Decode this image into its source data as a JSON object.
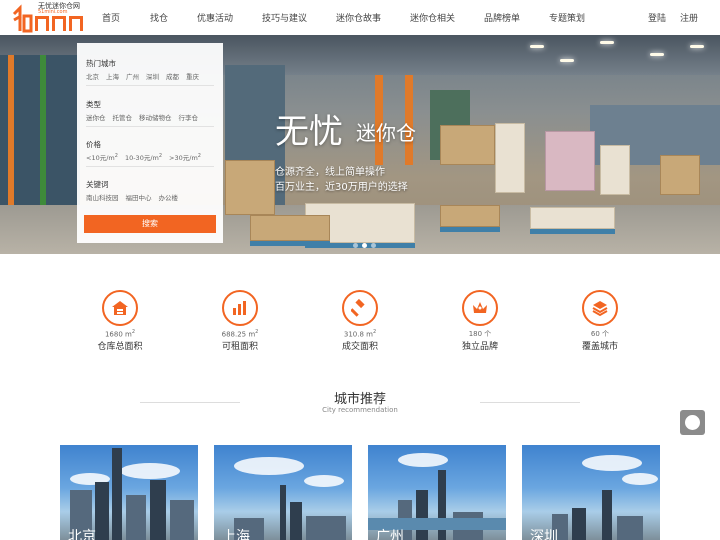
{
  "logo": {
    "text": "无忧迷你仓网",
    "url_text": "51mini.com",
    "brand_color": "#f26522"
  },
  "nav": {
    "items": [
      "首页",
      "找仓",
      "优惠活动",
      "技巧与建议",
      "迷你仓故事",
      "迷你仓相关",
      "品牌榜单",
      "专题策划"
    ],
    "login": "登陆",
    "register": "注册"
  },
  "search_panel": {
    "hot_city_label": "热门城市",
    "hot_cities": [
      "北京",
      "上海",
      "广州",
      "深圳",
      "成都",
      "重庆"
    ],
    "type_label": "类型",
    "types": [
      "迷你仓",
      "托管仓",
      "移动储物仓",
      "行李仓"
    ],
    "price_label": "价格",
    "prices": [
      "<10元/m",
      "10-30元/m",
      ">30元/m"
    ],
    "price_sup": "2",
    "keyword_label": "关键词",
    "keywords": [
      "南山科技园",
      "福田中心",
      "办公楼"
    ],
    "search_button": "搜索"
  },
  "hero": {
    "title": "无忧",
    "subtitle": "迷你仓",
    "line1": "仓源齐全，线上简单操作",
    "line2": "百万业主，近30万用户的选择"
  },
  "stats": [
    {
      "value": "1680  m",
      "sup": "2",
      "label": "仓库总面积",
      "icon": "warehouse-icon"
    },
    {
      "value": "688.25  m",
      "sup": "2",
      "label": "可租面积",
      "icon": "bar-chart-icon"
    },
    {
      "value": "310.8  m",
      "sup": "2",
      "label": "成交面积",
      "icon": "gavel-icon"
    },
    {
      "value": "180  个",
      "sup": "",
      "label": "独立品牌",
      "icon": "crown-icon"
    },
    {
      "value": "60  个",
      "sup": "",
      "label": "覆盖城市",
      "icon": "layers-icon"
    }
  ],
  "section": {
    "title": "城市推荐",
    "subtitle": "City recommendation"
  },
  "cities": [
    {
      "name": "北京"
    },
    {
      "name": "上海"
    },
    {
      "name": "广州"
    },
    {
      "name": "深圳"
    }
  ]
}
